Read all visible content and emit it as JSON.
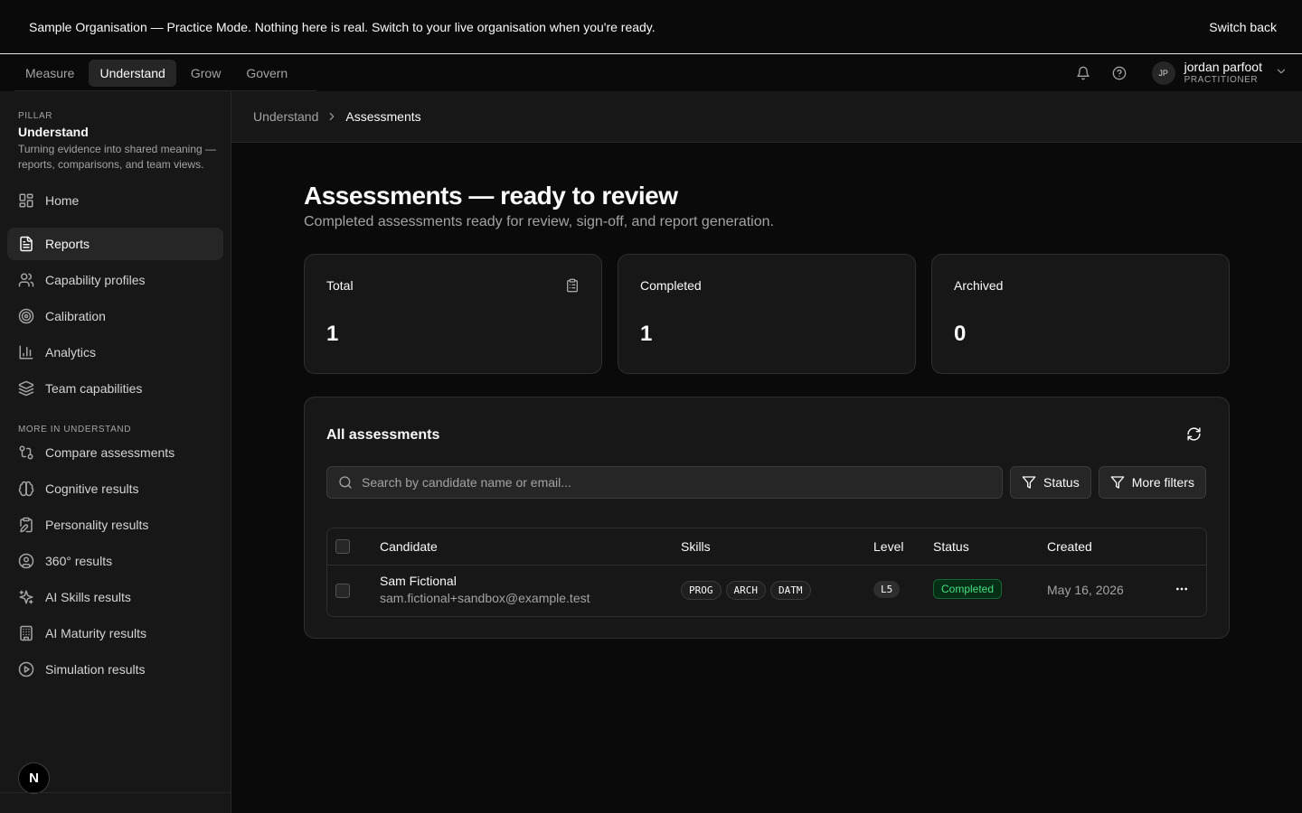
{
  "banner": {
    "strong": "Sample Organisation — Practice Mode.",
    "text": "Nothing here is real. Switch to your live organisation when you're ready.",
    "switch_label": "Switch back"
  },
  "topnav": {
    "tabs": [
      {
        "label": "Measure"
      },
      {
        "label": "Understand",
        "active": true
      },
      {
        "label": "Grow"
      },
      {
        "label": "Govern"
      }
    ],
    "user": {
      "initials": "JP",
      "name": "jordan parfoot",
      "role": "PRACTITIONER"
    }
  },
  "sidebar": {
    "pillar_kicker": "PILLAR",
    "pillar_title": "Understand",
    "pillar_desc": "Turning evidence into shared meaning — reports, comparisons, and team views.",
    "items": [
      {
        "label": "Home",
        "icon": "home-grid-icon"
      },
      {
        "label": "Reports",
        "icon": "document-icon",
        "active": true
      },
      {
        "label": "Capability profiles",
        "icon": "users-icon"
      },
      {
        "label": "Calibration",
        "icon": "target-icon"
      },
      {
        "label": "Analytics",
        "icon": "bar-chart-icon"
      },
      {
        "label": "Team capabilities",
        "icon": "layers-icon"
      }
    ],
    "more_label": "MORE IN UNDERSTAND",
    "more_items": [
      {
        "label": "Compare assessments",
        "icon": "compare-icon"
      },
      {
        "label": "Cognitive results",
        "icon": "brain-icon"
      },
      {
        "label": "Personality results",
        "icon": "clipboard-pen-icon"
      },
      {
        "label": "360° results",
        "icon": "user-circle-icon"
      },
      {
        "label": "AI Skills results",
        "icon": "sparkles-icon"
      },
      {
        "label": "AI Maturity results",
        "icon": "building-chart-icon"
      },
      {
        "label": "Simulation results",
        "icon": "play-circle-icon"
      }
    ],
    "badge": "N"
  },
  "breadcrumb": {
    "parent": "Understand",
    "current": "Assessments"
  },
  "main": {
    "title": "Assessments — ready to review",
    "subtitle": "Completed assessments ready for review, sign-off, and report generation.",
    "stats": [
      {
        "label": "Total",
        "value": "1"
      },
      {
        "label": "Completed",
        "value": "1"
      },
      {
        "label": "Archived",
        "value": "0"
      }
    ],
    "panel": {
      "title": "All assessments",
      "search_placeholder": "Search by candidate name or email...",
      "status_filter": "Status",
      "more_filters": "More filters",
      "columns": [
        "Candidate",
        "Skills",
        "Level",
        "Status",
        "Created"
      ],
      "rows": [
        {
          "name": "Sam Fictional",
          "email": "sam.fictional+sandbox@example.test",
          "skills": [
            "PROG",
            "ARCH",
            "DATM"
          ],
          "level": "L5",
          "status": "Completed",
          "created": "May 16, 2026"
        }
      ]
    }
  },
  "colors": {
    "accent_green": "#4ade80",
    "background": "#0a0a0a",
    "surface": "#171717"
  }
}
